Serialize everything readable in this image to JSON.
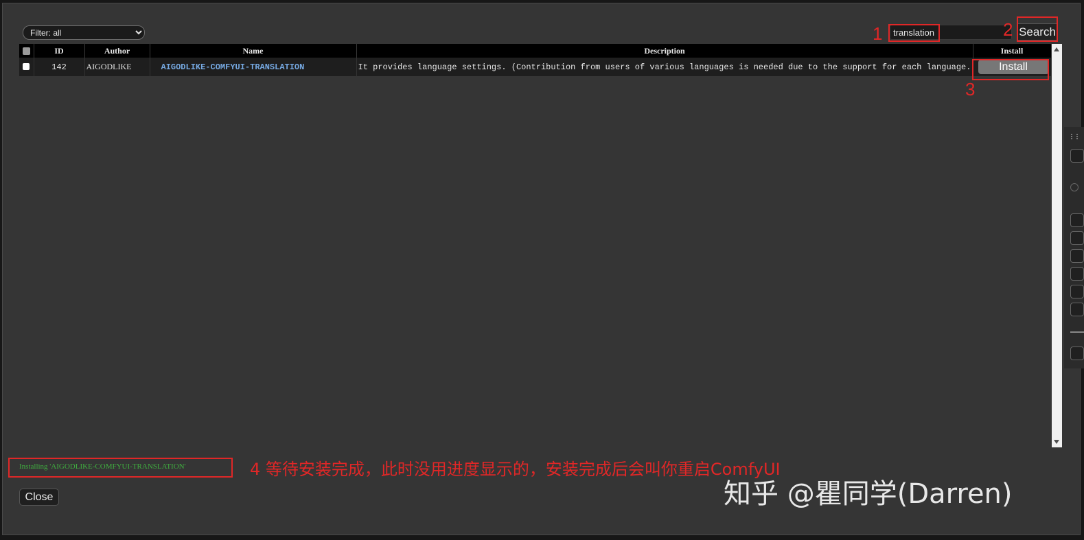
{
  "filter": {
    "selected": "Filter: all"
  },
  "search": {
    "value": "translation",
    "button_label": "Search"
  },
  "table": {
    "headers": {
      "id": "ID",
      "author": "Author",
      "name": "Name",
      "description": "Description",
      "install": "Install"
    },
    "rows": [
      {
        "id": "142",
        "author": "AIGODLIKE",
        "name": "AIGODLIKE-COMFYUI-TRANSLATION",
        "description": "It provides language settings. (Contribution from users of various languages is needed due to the support for each language.)",
        "install_label": "Install"
      }
    ]
  },
  "status": {
    "text": "Installing 'AIGODLIKE-COMFYUI-TRANSLATION'"
  },
  "close_label": "Close",
  "annotations": {
    "step1": "1",
    "step2": "2",
    "step3": "3",
    "step4_text": "4 等待安装完成，此时没用进度显示的，安装完成后会叫你重启ComfyUI"
  },
  "watermark": "知乎 @瞿同学(Darren)",
  "colors": {
    "annotation": "#e02727",
    "link": "#76a9e2",
    "status": "#3fae3f"
  }
}
